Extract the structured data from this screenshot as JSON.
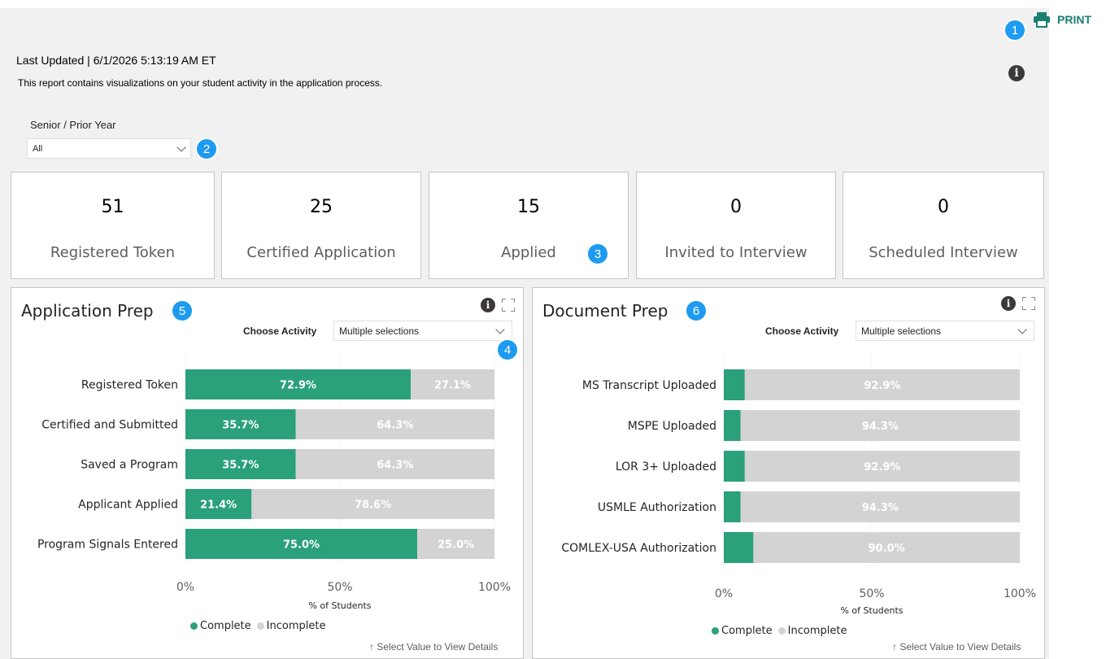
{
  "header": {
    "print_label": "PRINT",
    "last_updated": "Last Updated | 6/1/2026 5:13:19 AM ET",
    "description": "This report contains visualizations on your student activity in the application process."
  },
  "badges": [
    "1",
    "2",
    "3",
    "4",
    "5",
    "6"
  ],
  "filter": {
    "title": "Senior / Prior Year",
    "value": "All"
  },
  "kpis": [
    {
      "value": "51",
      "label": "Registered Token"
    },
    {
      "value": "25",
      "label": "Certified Application"
    },
    {
      "value": "15",
      "label": "Applied"
    },
    {
      "value": "0",
      "label": "Invited to Interview"
    },
    {
      "value": "0",
      "label": "Scheduled Interview"
    }
  ],
  "colors": {
    "complete": "#2aa07b",
    "incomplete": "#d3d3d3",
    "accent": "#1a7f72",
    "badge": "#1e9bf0"
  },
  "icons": {
    "print": "printer-icon",
    "info": "info-icon",
    "expand": "expand-icon",
    "chevron": "chevron-down-icon",
    "arrow": "arrow-up-icon"
  },
  "panels": {
    "left": {
      "title": "Application Prep",
      "choose_label": "Choose Activity",
      "dropdown_value": "Multiple selections",
      "legend": {
        "complete": "Complete",
        "incomplete": "Incomplete"
      },
      "xlabel": "% of Students",
      "note": "Select Value to View Details"
    },
    "right": {
      "title": "Document Prep",
      "choose_label": "Choose Activity",
      "dropdown_value": "Multiple selections",
      "legend": {
        "complete": "Complete",
        "incomplete": "Incomplete"
      },
      "xlabel": "% of Students",
      "note": "Select Value to View Details"
    }
  },
  "chart_data": [
    {
      "type": "bar",
      "orientation": "horizontal-stacked-100",
      "title": "Application Prep",
      "categories": [
        "Registered Token",
        "Certified and Submitted",
        "Saved a Program",
        "Applicant Applied",
        "Program Signals Entered"
      ],
      "series": [
        {
          "name": "Complete",
          "values": [
            72.9,
            35.7,
            35.7,
            21.4,
            75.0
          ],
          "labels": [
            "72.9%",
            "35.7%",
            "35.7%",
            "21.4%",
            "75.0%"
          ]
        },
        {
          "name": "Incomplete",
          "values": [
            27.1,
            64.3,
            64.3,
            78.6,
            25.0
          ],
          "labels": [
            "27.1%",
            "64.3%",
            "64.3%",
            "78.6%",
            "25.0%"
          ]
        }
      ],
      "xlabel": "% of Students",
      "xlim": [
        0,
        100
      ],
      "ticks": [
        "0%",
        "50%",
        "100%"
      ],
      "grid": false,
      "legend": "bottom"
    },
    {
      "type": "bar",
      "orientation": "horizontal-stacked-100",
      "title": "Document Prep",
      "categories": [
        "MS Transcript Uploaded",
        "MSPE Uploaded",
        "LOR 3+ Uploaded",
        "USMLE Authorization",
        "COMLEX-USA Authorization"
      ],
      "series": [
        {
          "name": "Complete",
          "values": [
            7.1,
            5.7,
            7.1,
            5.7,
            10.0
          ],
          "labels": [
            "",
            "",
            "",
            "",
            ""
          ]
        },
        {
          "name": "Incomplete",
          "values": [
            92.9,
            94.3,
            92.9,
            94.3,
            90.0
          ],
          "labels": [
            "92.9%",
            "94.3%",
            "92.9%",
            "94.3%",
            "90.0%"
          ]
        }
      ],
      "xlabel": "% of Students",
      "xlim": [
        0,
        100
      ],
      "ticks": [
        "0%",
        "50%",
        "100%"
      ],
      "grid": false,
      "legend": "bottom"
    }
  ]
}
